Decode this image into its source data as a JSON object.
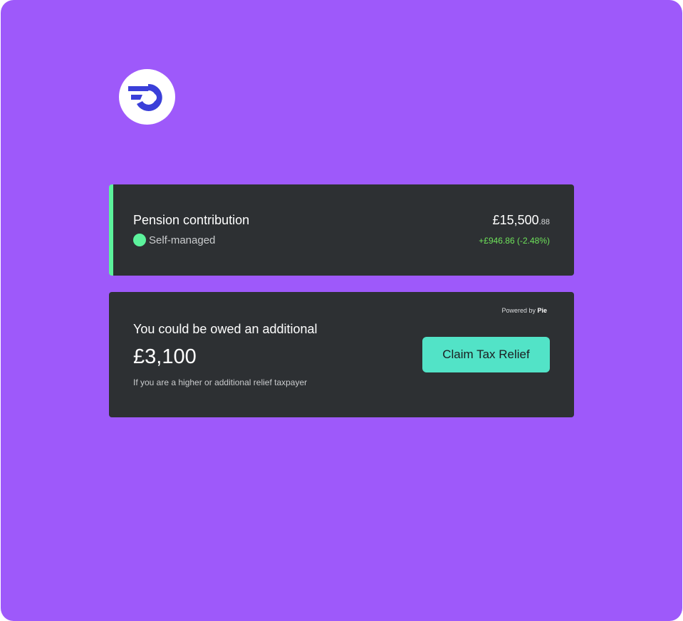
{
  "brand": {
    "logo_icon": "brand-logo-icon",
    "logo_color": "#3a3fd9",
    "background_color": "#9e59fa"
  },
  "pension": {
    "title": "Pension contribution",
    "status_label": "Self-managed",
    "status_color": "#5cf29c",
    "amount_main": "£15,500",
    "amount_pence": ".88",
    "change": "+£946.86 (-2.48%)",
    "change_color": "#6ee25a"
  },
  "tax_relief": {
    "powered_by_prefix": "Powered by",
    "powered_by_brand": "Pie",
    "heading": "You could be owed an additional",
    "amount": "£3,100",
    "note": "If you are a higher or additional relief taxpayer",
    "button_label": "Claim Tax Relief",
    "button_color": "#52e3c7"
  }
}
